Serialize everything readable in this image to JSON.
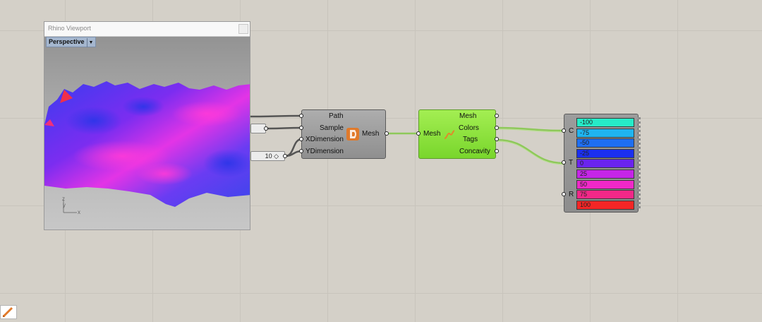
{
  "viewport": {
    "title": "Rhino Viewport",
    "view_name": "Perspective",
    "axes": {
      "z": "z",
      "y": "y",
      "x": "x"
    }
  },
  "slider": {
    "value": "10 ◇"
  },
  "mesh_component": {
    "inputs": [
      "Path",
      "Sample",
      "XDimension",
      "YDimension"
    ],
    "output": "Mesh",
    "icon": "terrain-plugin-icon"
  },
  "analysis_component": {
    "input": "Mesh",
    "outputs": [
      "Mesh",
      "Colors",
      "Tags",
      "Concavity"
    ],
    "icon": "curve-analysis-icon"
  },
  "legend": {
    "inputs": [
      "C",
      "T",
      "R"
    ],
    "items": [
      {
        "label": "-100",
        "color": "#27ebc8"
      },
      {
        "label": "-75",
        "color": "#1fb4f0"
      },
      {
        "label": "-50",
        "color": "#1e6ef2"
      },
      {
        "label": "-25",
        "color": "#1b2ff0"
      },
      {
        "label": "0",
        "color": "#6a24ee"
      },
      {
        "label": "25",
        "color": "#c525e8"
      },
      {
        "label": "50",
        "color": "#f028c8"
      },
      {
        "label": "75",
        "color": "#f32888"
      },
      {
        "label": "100",
        "color": "#f42626"
      }
    ]
  },
  "colors": {
    "canvas": "#d4d0c8",
    "wire_data": "#5e5e5e",
    "wire_selected": "#8ec95a"
  }
}
